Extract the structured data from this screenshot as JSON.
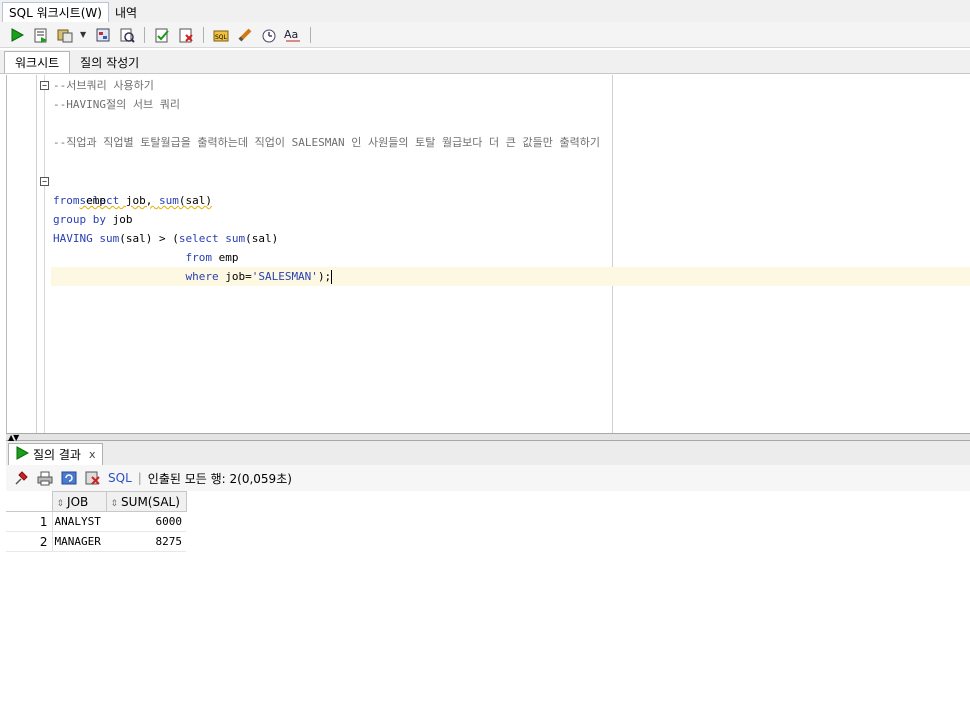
{
  "doc_tabs": [
    {
      "label": "SQL 워크시트(W)"
    },
    {
      "label": "내역"
    }
  ],
  "toolbar_icons": [
    "run-statement-icon",
    "run-script-icon",
    "autotrace-icon",
    "explain-plan-icon",
    "sql-tuning-icon",
    "commit-icon",
    "rollback-icon",
    "sql-format-icon",
    "clear-icon",
    "history-icon",
    "case-change-icon"
  ],
  "sub_tabs": [
    {
      "label": "워크시트"
    },
    {
      "label": "질의 작성기"
    }
  ],
  "editor": {
    "lines": [
      "--서브쿼리 사용하기",
      "--HAVING절의 서브 쿼리",
      "",
      "--직업과 직업별 토탈월급을 출력하는데 직업이 SALESMAN 인 사원들의 토탈 월급보다 더 큰 값들만 출력하기",
      "",
      "select job, sum(sal)",
      "from emp",
      "group by job",
      "HAVING sum(sal) > (select sum(sal)",
      "                    from emp",
      "                    where job='SALESMAN');"
    ]
  },
  "results": {
    "tab_label": "질의 결과",
    "close": "x",
    "sql_link": "SQL",
    "separator": "|",
    "status": "인출된 모든 행: 2(0,059초)",
    "columns": [
      "JOB",
      "SUM(SAL)"
    ],
    "rows": [
      {
        "num": "1",
        "job": "ANALYST",
        "sum": "6000"
      },
      {
        "num": "2",
        "job": "MANAGER",
        "sum": "8275"
      }
    ]
  }
}
